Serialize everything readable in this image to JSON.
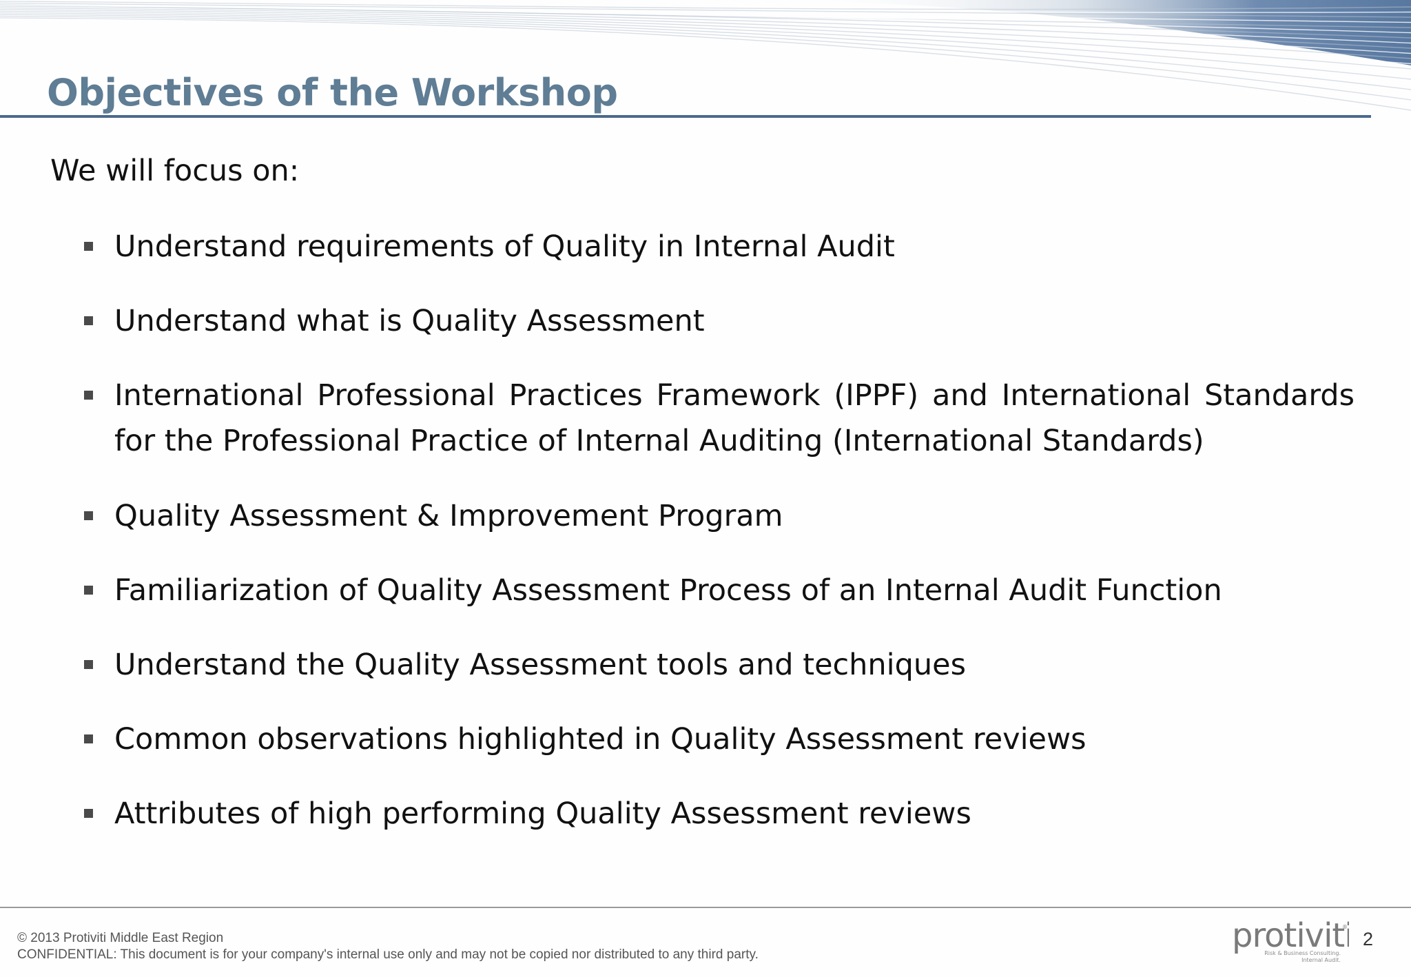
{
  "slide": {
    "title": "Objectives of the Workshop",
    "intro": "We will focus on:",
    "bullets": [
      "Understand requirements of Quality in Internal Audit",
      "Understand what is Quality Assessment",
      "International Professional Practices Framework (IPPF) and International Standards for the Professional Practice of Internal Auditing (International Standards)",
      "Quality Assessment & Improvement Program",
      "Familiarization of Quality Assessment Process of an Internal Audit Function",
      "Understand the Quality Assessment tools and techniques",
      "Common observations highlighted in Quality Assessment reviews",
      "Attributes of high performing Quality Assessment reviews"
    ],
    "bullet_icon": "square-bullet-icon"
  },
  "footer": {
    "copyright": "© 2013 Protiviti Middle East Region",
    "confidential": "CONFIDENTIAL: This document is for your company's internal use only and may not be copied nor distributed to any third party.",
    "logo_text": "protiviti",
    "logo_tagline_1": "Risk & Business Consulting.",
    "logo_tagline_2": "Internal Audit.",
    "page_number": "2"
  },
  "colors": {
    "title": "#5f7d94",
    "title_rule": "#4a6a8c",
    "header_wave": "#5878a0",
    "body_text": "#111111",
    "footer_text": "#555555"
  }
}
